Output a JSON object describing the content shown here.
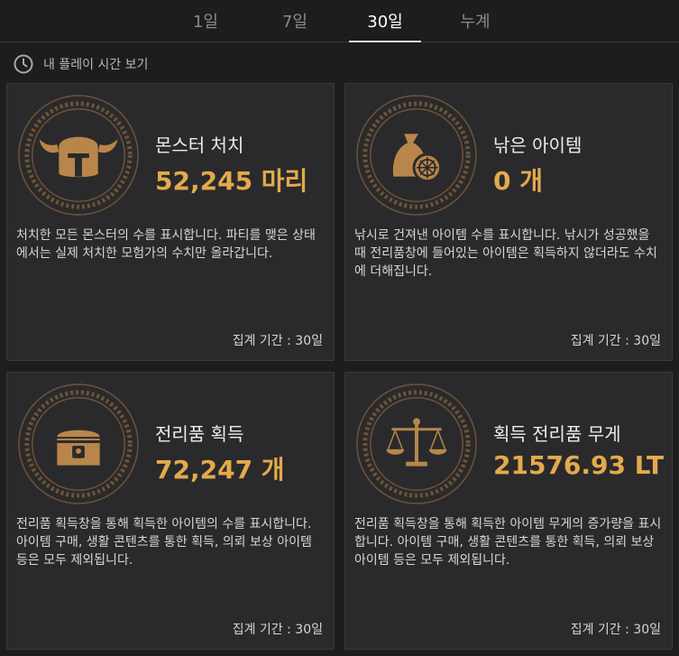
{
  "tabs": [
    {
      "label": "1일"
    },
    {
      "label": "7일"
    },
    {
      "label": "30일"
    },
    {
      "label": "누계"
    }
  ],
  "subheader": {
    "label": "내 플레이 시간 보기",
    "icon": "clock-icon"
  },
  "cards": [
    {
      "icon": "viking-helmet-icon",
      "title": "몬스터 처치",
      "value": "52,245 마리",
      "description": "처치한 모든 몬스터의 수를 표시합니다. 파티를 맺은 상태에서는 실제 처치한 모험가의 수치만 올라갑니다.",
      "period": "집계 기간 : 30일"
    },
    {
      "icon": "fishing-bag-icon",
      "title": "낚은 아이템",
      "value": "0 개",
      "description": "낚시로 건져낸 아이템 수를 표시합니다. 낚시가 성공했을 때 전리품창에 들어있는 아이템은 획득하지 않더라도 수치에 더해집니다.",
      "period": "집계 기간 : 30일"
    },
    {
      "icon": "treasure-chest-icon",
      "title": "전리품 획득",
      "value": "72,247 개",
      "description": "전리품 획득창을 통해 획득한 아이템의 수를 표시합니다. 아이템 구매, 생활 콘텐츠를 통한 획득, 의뢰 보상 아이템 등은 모두 제외됩니다.",
      "period": "집계 기간 : 30일"
    },
    {
      "icon": "scales-icon",
      "title": "획득 전리품 무게",
      "value": "21576.93 LT",
      "description": "전리품 획득창을 통해 획득한 아이템 무게의 증가량을 표시합니다. 아이템 구매, 생활 콘텐츠를 통한 획득, 의뢰 보상 아이템 등은 모두 제외됩니다.",
      "period": "집계 기간 : 30일"
    }
  ],
  "colors": {
    "accent": "#e3aa4b",
    "emblem": "#8a6a43",
    "background": "#1d1d1f",
    "card": "#2a2a2c"
  }
}
